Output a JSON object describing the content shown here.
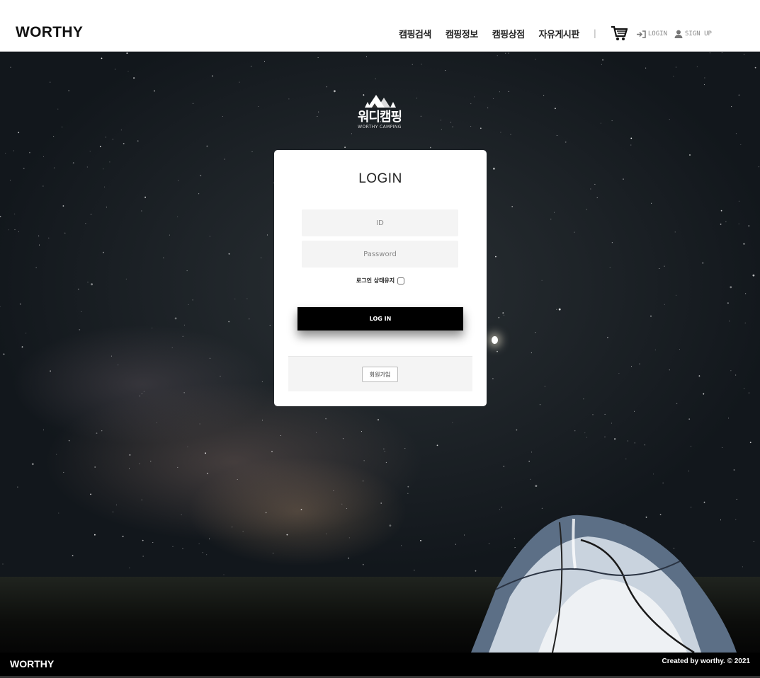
{
  "header": {
    "brand": "WORTHY",
    "nav": [
      "캠핑검색",
      "캠핑정보",
      "캠핑상점",
      "자유게시판"
    ],
    "separator": "|",
    "cart_icon": "cart-icon",
    "login_link": "LOGIN",
    "signup_link": "SIGN UP"
  },
  "logo": {
    "title_kr": "워디캠핑",
    "subtitle_en": "WORTHY CAMPING"
  },
  "login": {
    "title": "LOGIN",
    "id_placeholder": "ID",
    "password_placeholder": "Password",
    "keep_logged_in": "로그인 상태유지",
    "login_button": "LOG IN",
    "signup_button": "회원가입"
  },
  "footer": {
    "brand": "WORTHY",
    "copyright": "Created by worthy. © 2021"
  },
  "colors": {
    "header_bg": "#ffffff",
    "button_bg": "#000000",
    "footer_bg": "#000000",
    "field_bg": "#f4f4f4"
  }
}
